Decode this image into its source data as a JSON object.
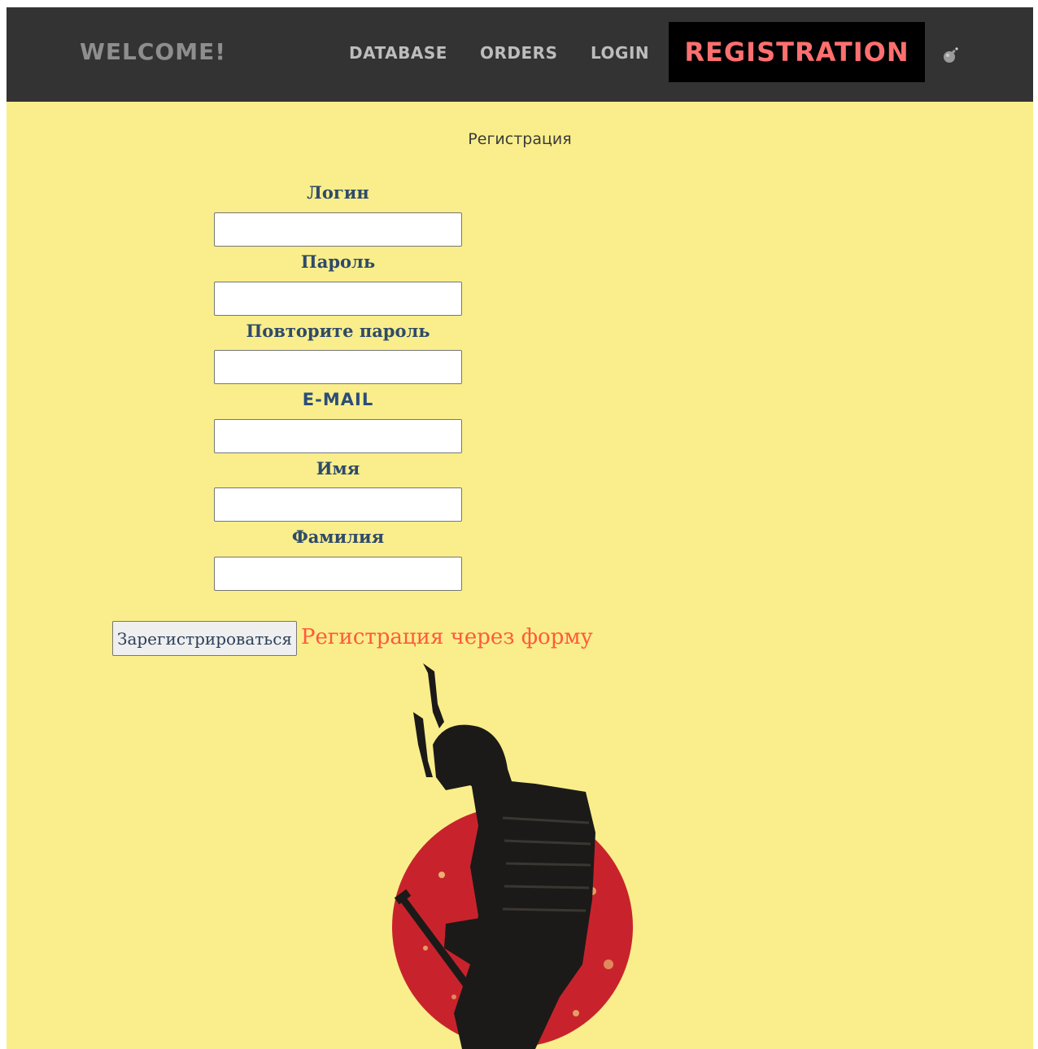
{
  "header": {
    "brand": "WELCOME!",
    "nav": {
      "database": "DATABASE",
      "orders": "ORDERS",
      "login": "LOGIN",
      "registration": "REGISTRATION"
    },
    "bomb_icon": "bomb-icon"
  },
  "main": {
    "title": "Регистрация",
    "form": {
      "fields": [
        {
          "label": "Логин",
          "value": ""
        },
        {
          "label": "Пароль",
          "value": ""
        },
        {
          "label": "Повторите пароль",
          "value": ""
        },
        {
          "label": "E-MAIL",
          "value": ""
        },
        {
          "label": "Имя",
          "value": ""
        },
        {
          "label": "Фамилия",
          "value": ""
        }
      ],
      "submit_label": "Зарегистрироваться",
      "alt_link": "Регистрация через форму"
    },
    "artwork": "samurai-silhouette-red-sun"
  },
  "colors": {
    "page_background": "#f9ee8b",
    "navbar_background": "#333333",
    "active_nav_background": "#000000",
    "active_nav_text": "#ff6f6f",
    "label_text": "#2f4a6a",
    "link_text": "#ff5a3c",
    "sun_red": "#c8232c"
  }
}
